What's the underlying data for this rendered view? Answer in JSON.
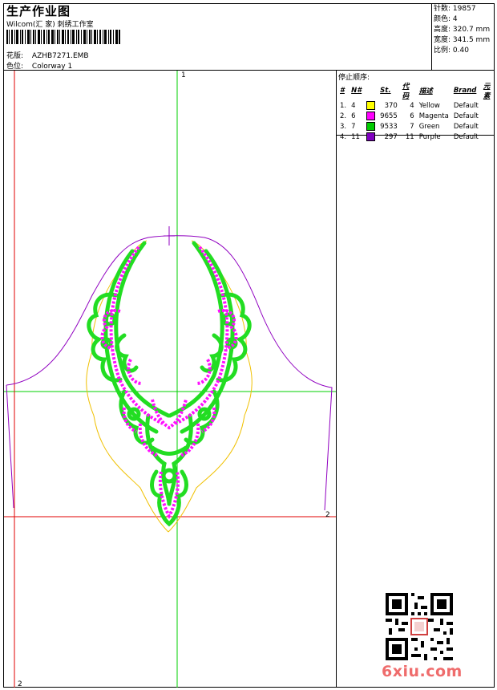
{
  "header": {
    "title": "生产作业图",
    "studio": "Wilcom(汇 家) 刺绣工作室",
    "pattern_label": "花版:",
    "pattern_value": "AZHB7271.EMB",
    "colorway_label": "色位:",
    "colorway_value": "Colorway 1"
  },
  "stats": [
    {
      "label": "针数:",
      "value": "19857"
    },
    {
      "label": "颜色:",
      "value": "4"
    },
    {
      "label": "高度:",
      "value": "320.7 mm"
    },
    {
      "label": "宽度:",
      "value": "341.5 mm"
    },
    {
      "label": "比例:",
      "value": "0.40"
    }
  ],
  "stop_sequence": {
    "title": "停止顺序:",
    "headers": [
      "#",
      "N#",
      "St.",
      "代码",
      "描述",
      "Brand",
      "元素"
    ],
    "rows": [
      {
        "idx": "1.",
        "n": "4",
        "color": "#ffff00",
        "st": "370",
        "code": "4",
        "desc": "Yellow",
        "brand": "Default"
      },
      {
        "idx": "2.",
        "n": "6",
        "color": "#ff00ff",
        "st": "9655",
        "code": "6",
        "desc": "Magenta",
        "brand": "Default"
      },
      {
        "idx": "3.",
        "n": "7",
        "color": "#00cc00",
        "st": "9533",
        "code": "7",
        "desc": "Green",
        "brand": "Default"
      },
      {
        "idx": "4.",
        "n": "11",
        "color": "#8000c0",
        "st": "297",
        "code": "11",
        "desc": "Purple",
        "brand": "Default"
      }
    ]
  },
  "markers": {
    "top": "1",
    "right": "2",
    "bottom": "2"
  },
  "colors": {
    "guide_green": "#00d000",
    "guide_red": "#e00000",
    "outline_purple": "#9000c0"
  },
  "watermark": {
    "site": "6xiu.com"
  }
}
